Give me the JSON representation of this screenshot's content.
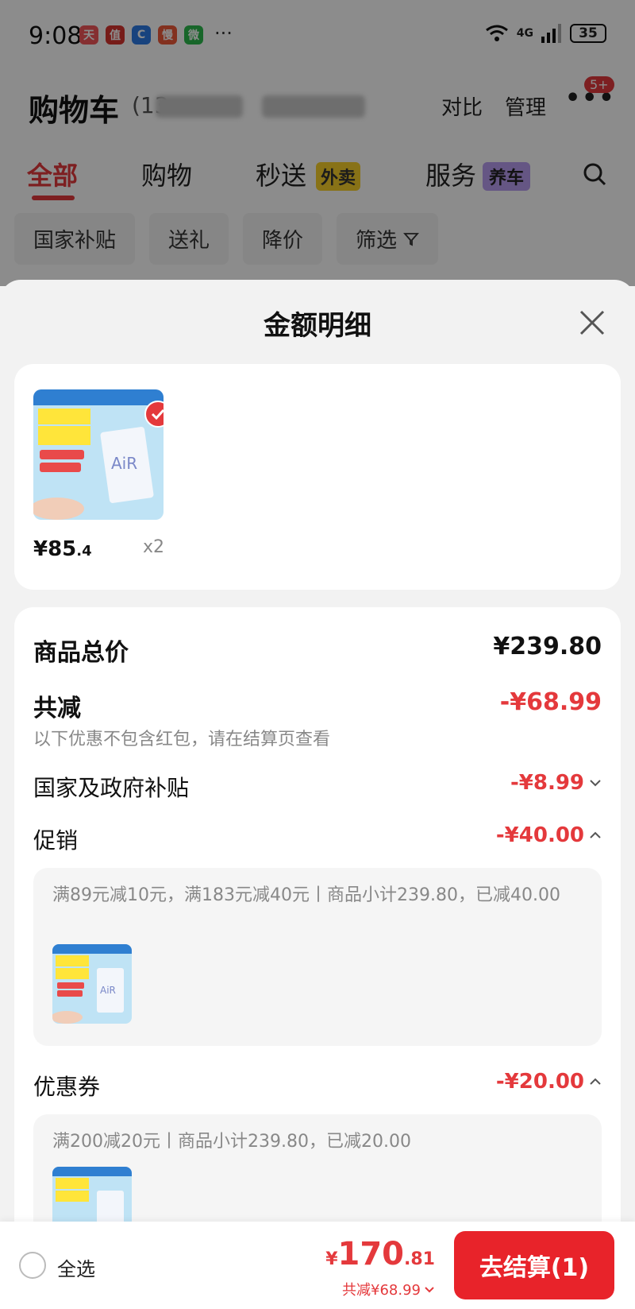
{
  "status_bar": {
    "time": "9:08",
    "network": "4G",
    "battery": "35",
    "apps": [
      {
        "icon": "tmall-app-icon",
        "color": "#f2565a",
        "glyph": "天"
      },
      {
        "icon": "zhi-app-icon",
        "color": "#d8332f",
        "glyph": "值"
      },
      {
        "icon": "c-app-icon",
        "color": "#2d7be5",
        "glyph": "C"
      },
      {
        "icon": "man-app-icon",
        "color": "#ef5a3a",
        "glyph": "慢"
      },
      {
        "icon": "wechat-app-icon",
        "color": "#2dbb4e",
        "glyph": "微"
      }
    ],
    "more": "···"
  },
  "header": {
    "title": "购物车",
    "count_prefix": "(13",
    "compare": "对比",
    "manage": "管理",
    "more_badge": "5+"
  },
  "tabs": [
    {
      "label": "全部",
      "active": true
    },
    {
      "label": "购物",
      "active": false
    },
    {
      "label": "秒送",
      "active": false,
      "tag": "外卖"
    },
    {
      "label": "服务",
      "active": false,
      "tag": "养车"
    }
  ],
  "chips": [
    "国家补贴",
    "送礼",
    "降价",
    "筛选"
  ],
  "sheet": {
    "title": "金额明细",
    "product": {
      "price_int": "¥85",
      "price_dec": ".4",
      "qty": "x2"
    },
    "subtotal": {
      "label": "商品总价",
      "value": "¥239.80"
    },
    "total_discount": {
      "label": "共减",
      "value": "-¥68.99",
      "hint": "以下优惠不包含红包，请在结算页查看"
    },
    "gov_subsidy": {
      "label": "国家及政府补贴",
      "value": "-¥8.99"
    },
    "promotion": {
      "label": "促销",
      "value": "-¥40.00",
      "detail": "满89元减10元，满183元减40元丨商品小计239.80，已减40.00"
    },
    "coupon": {
      "label": "优惠券",
      "value": "-¥20.00",
      "detail": "满200减20元丨商品小计239.80，已减20.00"
    }
  },
  "bottom_bar": {
    "select_all": "全选",
    "total_currency": "¥",
    "total_int": "170",
    "total_dec": ".81",
    "saved": "共减¥68.99",
    "checkout": "去结算(1)"
  },
  "colors": {
    "accent": "#e4393c",
    "checkout": "#e8232a"
  }
}
